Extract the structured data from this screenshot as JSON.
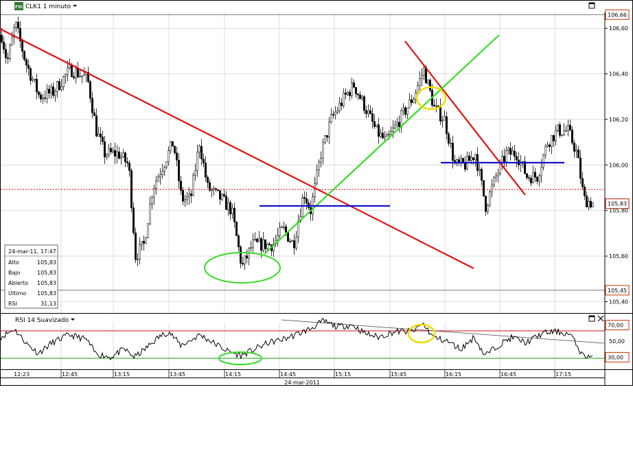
{
  "window": {
    "symbol_label": "CLK1 1 minuto",
    "logo_text": "FXI",
    "rsi_panel_label": "RSI 14 Suavizado"
  },
  "info_box": {
    "header": "24-mar-11, 17:47",
    "rows": [
      {
        "label": "Alto",
        "value": "105,83"
      },
      {
        "label": "Bajo",
        "value": "105,83"
      },
      {
        "label": "Abierto",
        "value": "105,83"
      },
      {
        "label": "Último",
        "value": "105,83"
      },
      {
        "label": "RSI",
        "value": "31,13"
      }
    ]
  },
  "colors": {
    "red_line": "#e01010",
    "green_line": "#33dd22",
    "blue_line": "#1010cc",
    "yellow_circle": "#eedd00",
    "price_series": "#000000",
    "badge_border": "#cc3300",
    "grid": "#c8c8c8"
  },
  "chart_data": [
    {
      "type": "candlestick",
      "title": "CLK1 1 minuto",
      "xlabel": "24-mar-2011",
      "x_ticks": [
        "12:23",
        "12:45",
        "13:15",
        "13:45",
        "14:15",
        "14:45",
        "15:15",
        "15:45",
        "16:15",
        "16:45",
        "17:15"
      ],
      "y_ticks": [
        "106,60",
        "106,40",
        "106,20",
        "106,00",
        "105,80",
        "105,60",
        "105,40"
      ],
      "ylim": [
        105.35,
        106.67
      ],
      "price_badges": [
        {
          "label": "106,66",
          "value": 106.66
        },
        {
          "label": "105,83",
          "value": 105.83
        },
        {
          "label": "105,45",
          "value": 105.45
        }
      ],
      "series": [
        {
          "name": "",
          "anchors": [
            {
              "t": 0,
              "v": 106.57
            },
            {
              "t": 8,
              "v": 106.45
            },
            {
              "t": 20,
              "v": 106.62
            },
            {
              "t": 35,
              "v": 106.45
            },
            {
              "t": 55,
              "v": 106.3
            },
            {
              "t": 75,
              "v": 106.32
            },
            {
              "t": 100,
              "v": 106.42
            },
            {
              "t": 125,
              "v": 106.38
            },
            {
              "t": 138,
              "v": 106.15
            },
            {
              "t": 150,
              "v": 106.05
            },
            {
              "t": 170,
              "v": 106.05
            },
            {
              "t": 185,
              "v": 106.0
            },
            {
              "t": 195,
              "v": 105.6
            },
            {
              "t": 207,
              "v": 105.65
            },
            {
              "t": 220,
              "v": 105.9
            },
            {
              "t": 235,
              "v": 106.0
            },
            {
              "t": 250,
              "v": 106.1
            },
            {
              "t": 262,
              "v": 105.85
            },
            {
              "t": 275,
              "v": 105.85
            },
            {
              "t": 288,
              "v": 106.1
            },
            {
              "t": 300,
              "v": 105.9
            },
            {
              "t": 320,
              "v": 105.85
            },
            {
              "t": 335,
              "v": 105.8
            },
            {
              "t": 350,
              "v": 105.55
            },
            {
              "t": 365,
              "v": 105.65
            },
            {
              "t": 380,
              "v": 105.65
            },
            {
              "t": 395,
              "v": 105.65
            },
            {
              "t": 410,
              "v": 105.72
            },
            {
              "t": 425,
              "v": 105.65
            },
            {
              "t": 440,
              "v": 105.88
            },
            {
              "t": 450,
              "v": 105.8
            },
            {
              "t": 465,
              "v": 106.05
            },
            {
              "t": 480,
              "v": 106.2
            },
            {
              "t": 500,
              "v": 106.3
            },
            {
              "t": 513,
              "v": 106.35
            },
            {
              "t": 530,
              "v": 106.25
            },
            {
              "t": 545,
              "v": 106.15
            },
            {
              "t": 560,
              "v": 106.1
            },
            {
              "t": 580,
              "v": 106.2
            },
            {
              "t": 600,
              "v": 106.3
            },
            {
              "t": 615,
              "v": 106.42
            },
            {
              "t": 630,
              "v": 106.25
            },
            {
              "t": 645,
              "v": 106.2
            },
            {
              "t": 660,
              "v": 106.0
            },
            {
              "t": 675,
              "v": 106.0
            },
            {
              "t": 690,
              "v": 106.05
            },
            {
              "t": 705,
              "v": 105.82
            },
            {
              "t": 720,
              "v": 105.95
            },
            {
              "t": 735,
              "v": 106.05
            },
            {
              "t": 750,
              "v": 106.05
            },
            {
              "t": 765,
              "v": 105.95
            },
            {
              "t": 780,
              "v": 105.95
            },
            {
              "t": 795,
              "v": 106.1
            },
            {
              "t": 810,
              "v": 106.15
            },
            {
              "t": 825,
              "v": 106.15
            },
            {
              "t": 838,
              "v": 106.05
            },
            {
              "t": 848,
              "v": 105.85
            },
            {
              "t": 862,
              "v": 105.83
            }
          ]
        }
      ]
    },
    {
      "type": "line",
      "title": "RSI 14 Suavizado",
      "y_ticks": [
        "70,00",
        "50,00",
        "30,00"
      ],
      "ylim": [
        15,
        85
      ],
      "levels": [
        70,
        30
      ],
      "series": [
        {
          "name": "",
          "anchors": [
            {
              "t": 0,
              "v": 55
            },
            {
              "t": 20,
              "v": 65
            },
            {
              "t": 40,
              "v": 45
            },
            {
              "t": 55,
              "v": 35
            },
            {
              "t": 75,
              "v": 48
            },
            {
              "t": 100,
              "v": 58
            },
            {
              "t": 125,
              "v": 52
            },
            {
              "t": 138,
              "v": 35
            },
            {
              "t": 160,
              "v": 30
            },
            {
              "t": 180,
              "v": 40
            },
            {
              "t": 195,
              "v": 30
            },
            {
              "t": 210,
              "v": 40
            },
            {
              "t": 230,
              "v": 55
            },
            {
              "t": 245,
              "v": 62
            },
            {
              "t": 262,
              "v": 45
            },
            {
              "t": 275,
              "v": 50
            },
            {
              "t": 290,
              "v": 58
            },
            {
              "t": 310,
              "v": 48
            },
            {
              "t": 330,
              "v": 38
            },
            {
              "t": 350,
              "v": 32
            },
            {
              "t": 370,
              "v": 40
            },
            {
              "t": 390,
              "v": 48
            },
            {
              "t": 410,
              "v": 52
            },
            {
              "t": 430,
              "v": 58
            },
            {
              "t": 450,
              "v": 65
            },
            {
              "t": 470,
              "v": 75
            },
            {
              "t": 490,
              "v": 68
            },
            {
              "t": 513,
              "v": 70
            },
            {
              "t": 530,
              "v": 60
            },
            {
              "t": 550,
              "v": 55
            },
            {
              "t": 575,
              "v": 62
            },
            {
              "t": 600,
              "v": 62
            },
            {
              "t": 615,
              "v": 72
            },
            {
              "t": 630,
              "v": 55
            },
            {
              "t": 650,
              "v": 50
            },
            {
              "t": 670,
              "v": 40
            },
            {
              "t": 690,
              "v": 55
            },
            {
              "t": 705,
              "v": 32
            },
            {
              "t": 725,
              "v": 45
            },
            {
              "t": 745,
              "v": 55
            },
            {
              "t": 765,
              "v": 48
            },
            {
              "t": 790,
              "v": 60
            },
            {
              "t": 810,
              "v": 62
            },
            {
              "t": 830,
              "v": 58
            },
            {
              "t": 848,
              "v": 32
            },
            {
              "t": 862,
              "v": 31
            }
          ]
        }
      ]
    }
  ]
}
